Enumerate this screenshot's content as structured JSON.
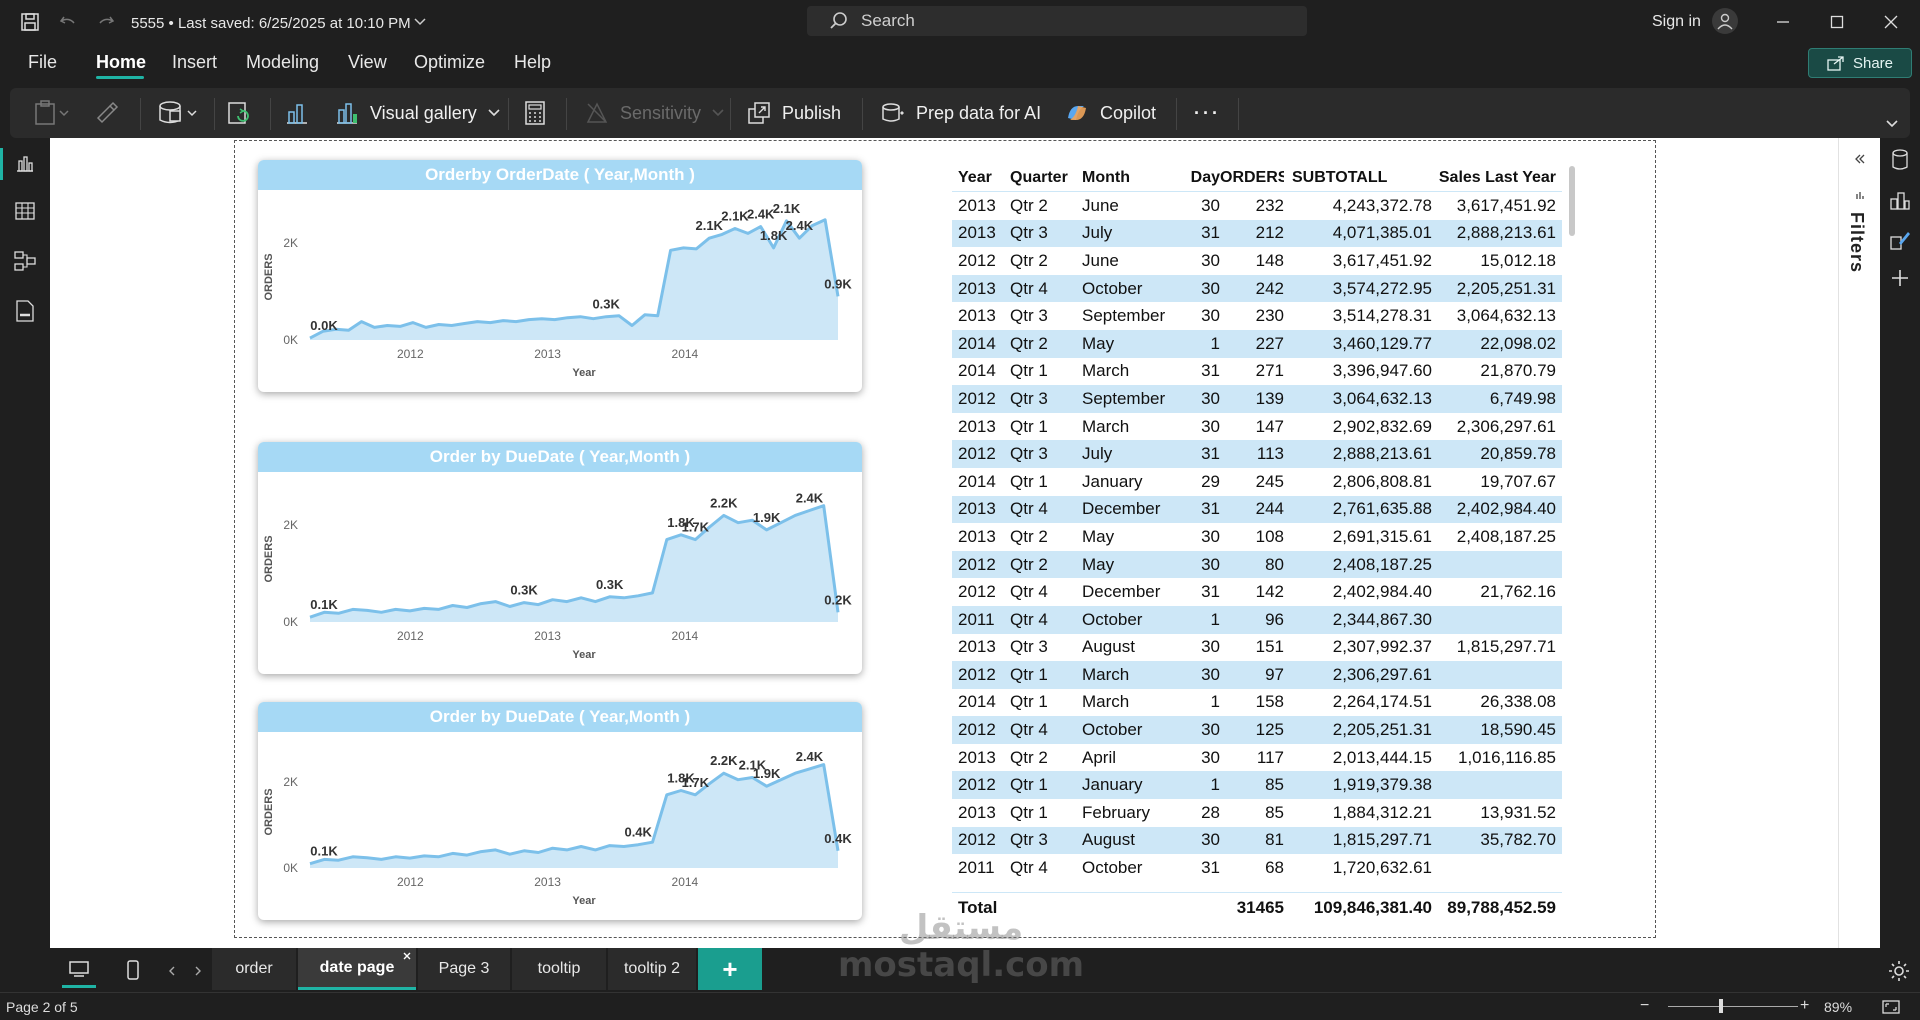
{
  "titlebar": {
    "file_title": "5555 • Last saved: 6/25/2025 at 10:10 PM",
    "search_placeholder": "Search",
    "sign_in": "Sign in"
  },
  "menu": [
    "File",
    "Home",
    "Insert",
    "Modeling",
    "View",
    "Optimize",
    "Help"
  ],
  "share_label": "Share",
  "ribbon": {
    "visual_gallery": "Visual gallery",
    "sensitivity": "Sensitivity",
    "publish": "Publish",
    "prep_ai": "Prep data for AI",
    "copilot": "Copilot"
  },
  "filters_label": "Filters",
  "chart_data": [
    {
      "type": "area",
      "title": "Orderby OrderDate ( Year,Month )",
      "xlabel": "Year",
      "ylabel": "ORDERS",
      "x_ticks": [
        "2012",
        "2013",
        "2014"
      ],
      "y_ticks": [
        "0K",
        "2K"
      ],
      "ylim": [
        0,
        2600
      ],
      "values": [
        40,
        180,
        220,
        200,
        380,
        260,
        300,
        280,
        360,
        260,
        320,
        300,
        340,
        380,
        360,
        400,
        380,
        420,
        440,
        420,
        460,
        480,
        440,
        480,
        500,
        300,
        520,
        500,
        1850,
        1900,
        1880,
        2100,
        2180,
        2300,
        2200,
        2340,
        1900,
        2460,
        2100,
        2360,
        2480,
        900
      ],
      "labels": [
        {
          "i": 0,
          "text": "0.0K"
        },
        {
          "i": 23,
          "text": "0.3K"
        },
        {
          "i": 31,
          "text": "2.1K"
        },
        {
          "i": 33,
          "text": "2.1K"
        },
        {
          "i": 35,
          "text": "2.4K"
        },
        {
          "i": 36,
          "text": "1.8K"
        },
        {
          "i": 37,
          "text": "2.1K"
        },
        {
          "i": 38,
          "text": "2.4K"
        },
        {
          "i": 41,
          "text": "0.9K"
        }
      ],
      "grid": false
    },
    {
      "type": "area",
      "title": "Order by DueDate ( Year,Month )",
      "xlabel": "Year",
      "ylabel": "ORDERS",
      "x_ticks": [
        "2012",
        "2013",
        "2014"
      ],
      "y_ticks": [
        "0K",
        "2K"
      ],
      "ylim": [
        0,
        2600
      ],
      "values": [
        100,
        200,
        180,
        260,
        240,
        200,
        260,
        230,
        280,
        260,
        340,
        300,
        380,
        420,
        320,
        400,
        360,
        460,
        420,
        500,
        420,
        520,
        500,
        540,
        600,
        1700,
        1800,
        1700,
        1960,
        2200,
        2050,
        2100,
        1900,
        2050,
        2200,
        2300,
        2400,
        200
      ],
      "labels": [
        {
          "i": 0,
          "text": "0.1K"
        },
        {
          "i": 15,
          "text": "0.3K"
        },
        {
          "i": 21,
          "text": "0.3K"
        },
        {
          "i": 26,
          "text": "1.8K"
        },
        {
          "i": 27,
          "text": "1.7K"
        },
        {
          "i": 29,
          "text": "2.2K"
        },
        {
          "i": 32,
          "text": "1.9K"
        },
        {
          "i": 35,
          "text": "2.4K"
        },
        {
          "i": 37,
          "text": "0.2K"
        }
      ],
      "grid": false
    },
    {
      "type": "area",
      "title": "Order by DueDate ( Year,Month )",
      "xlabel": "Year",
      "ylabel": "ORDERS",
      "x_ticks": [
        "2012",
        "2013",
        "2014"
      ],
      "y_ticks": [
        "0K",
        "2K"
      ],
      "ylim": [
        0,
        2600
      ],
      "values": [
        100,
        200,
        180,
        260,
        240,
        200,
        260,
        230,
        280,
        260,
        340,
        300,
        380,
        420,
        320,
        400,
        360,
        460,
        420,
        500,
        420,
        520,
        500,
        540,
        600,
        1700,
        1800,
        1700,
        1960,
        2200,
        2050,
        2100,
        1900,
        2050,
        2200,
        2300,
        2400,
        400
      ],
      "labels": [
        {
          "i": 0,
          "text": "0.1K"
        },
        {
          "i": 23,
          "text": "0.4K"
        },
        {
          "i": 26,
          "text": "1.8K"
        },
        {
          "i": 27,
          "text": "1.7K"
        },
        {
          "i": 29,
          "text": "2.2K"
        },
        {
          "i": 31,
          "text": "2.1K"
        },
        {
          "i": 32,
          "text": "1.9K"
        },
        {
          "i": 35,
          "text": "2.4K"
        },
        {
          "i": 37,
          "text": "0.4K"
        }
      ],
      "grid": false
    },
    {
      "type": "table",
      "columns": [
        "Year",
        "Quarter",
        "Month",
        "Day",
        "ORDERS",
        "SUBTOTALL",
        "Sales Last Year"
      ],
      "rows": [
        [
          "2013",
          "Qtr 2",
          "June",
          "30",
          "232",
          "4,243,372.78",
          "3,617,451.92"
        ],
        [
          "2013",
          "Qtr 3",
          "July",
          "31",
          "212",
          "4,071,385.01",
          "2,888,213.61"
        ],
        [
          "2012",
          "Qtr 2",
          "June",
          "30",
          "148",
          "3,617,451.92",
          "15,012.18"
        ],
        [
          "2013",
          "Qtr 4",
          "October",
          "30",
          "242",
          "3,574,272.95",
          "2,205,251.31"
        ],
        [
          "2013",
          "Qtr 3",
          "September",
          "30",
          "230",
          "3,514,278.31",
          "3,064,632.13"
        ],
        [
          "2014",
          "Qtr 2",
          "May",
          "1",
          "227",
          "3,460,129.77",
          "22,098.02"
        ],
        [
          "2014",
          "Qtr 1",
          "March",
          "31",
          "271",
          "3,396,947.60",
          "21,870.79"
        ],
        [
          "2012",
          "Qtr 3",
          "September",
          "30",
          "139",
          "3,064,632.13",
          "6,749.98"
        ],
        [
          "2013",
          "Qtr 1",
          "March",
          "30",
          "147",
          "2,902,832.69",
          "2,306,297.61"
        ],
        [
          "2012",
          "Qtr 3",
          "July",
          "31",
          "113",
          "2,888,213.61",
          "20,859.78"
        ],
        [
          "2014",
          "Qtr 1",
          "January",
          "29",
          "245",
          "2,806,808.81",
          "19,707.67"
        ],
        [
          "2013",
          "Qtr 4",
          "December",
          "31",
          "244",
          "2,761,635.88",
          "2,402,984.40"
        ],
        [
          "2013",
          "Qtr 2",
          "May",
          "30",
          "108",
          "2,691,315.61",
          "2,408,187.25"
        ],
        [
          "2012",
          "Qtr 2",
          "May",
          "30",
          "80",
          "2,408,187.25",
          ""
        ],
        [
          "2012",
          "Qtr 4",
          "December",
          "31",
          "142",
          "2,402,984.40",
          "21,762.16"
        ],
        [
          "2011",
          "Qtr 4",
          "October",
          "1",
          "96",
          "2,344,867.30",
          ""
        ],
        [
          "2013",
          "Qtr 3",
          "August",
          "30",
          "151",
          "2,307,992.37",
          "1,815,297.71"
        ],
        [
          "2012",
          "Qtr 1",
          "March",
          "30",
          "97",
          "2,306,297.61",
          ""
        ],
        [
          "2014",
          "Qtr 1",
          "March",
          "1",
          "158",
          "2,264,174.51",
          "26,338.08"
        ],
        [
          "2012",
          "Qtr 4",
          "October",
          "30",
          "125",
          "2,205,251.31",
          "18,590.45"
        ],
        [
          "2013",
          "Qtr 2",
          "April",
          "30",
          "117",
          "2,013,444.15",
          "1,016,116.85"
        ],
        [
          "2012",
          "Qtr 1",
          "January",
          "1",
          "85",
          "1,919,379.38",
          ""
        ],
        [
          "2013",
          "Qtr 1",
          "February",
          "28",
          "85",
          "1,884,312.21",
          "13,931.52"
        ],
        [
          "2012",
          "Qtr 3",
          "August",
          "30",
          "81",
          "1,815,297.71",
          "35,782.70"
        ],
        [
          "2011",
          "Qtr 4",
          "October",
          "31",
          "68",
          "1,720,632.61",
          ""
        ]
      ],
      "total": {
        "label": "Total",
        "orders": "31465",
        "subtotal": "109,846,381.40",
        "sales_last_year": "89,788,452.59"
      }
    }
  ],
  "tabs": [
    "order",
    "date page",
    "Page 3",
    "tooltip",
    "tooltip 2"
  ],
  "active_tab": "date page",
  "add_tab": "+",
  "status": {
    "page": "Page 2 of 5",
    "zoom": "89%"
  },
  "watermark": {
    "arabic": "مستقل",
    "latin": "mostaql.com"
  },
  "colors": {
    "accent": "#1fb4a5",
    "chart_fill": "#cde7f7",
    "chart_line": "#7cc0ea",
    "chart_title_bg": "#a6d9f5"
  }
}
